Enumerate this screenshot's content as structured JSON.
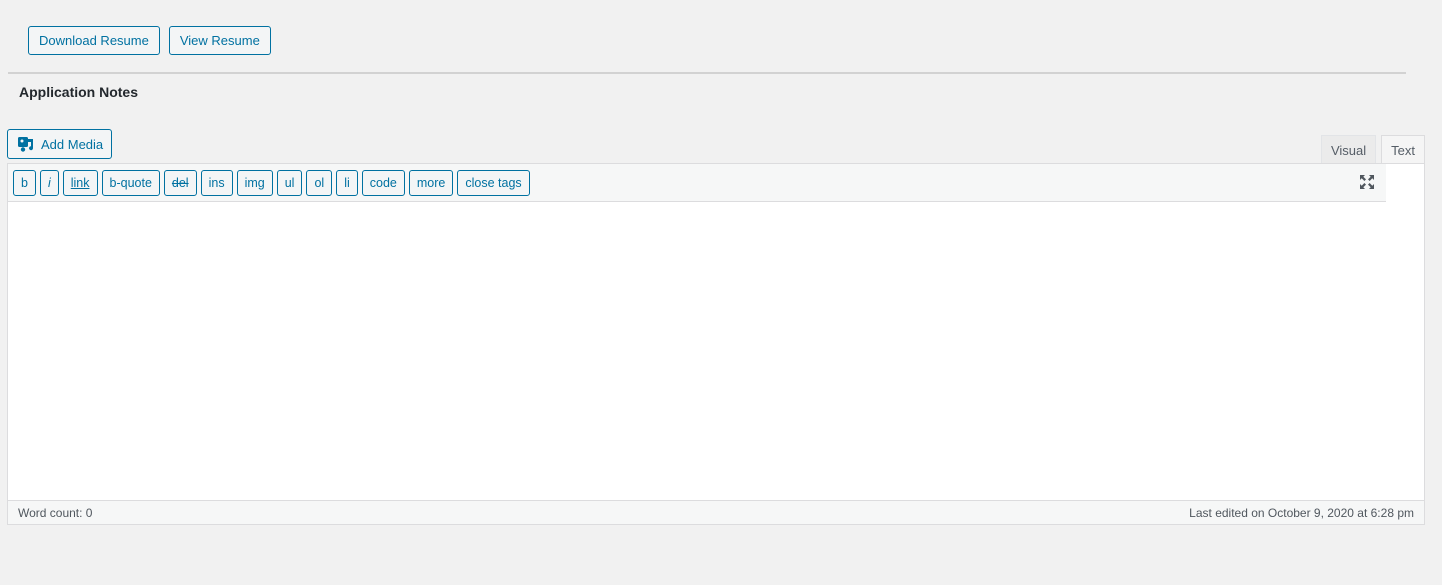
{
  "actions": {
    "download_resume": "Download Resume",
    "view_resume": "View Resume"
  },
  "section": {
    "title": "Application Notes"
  },
  "editor": {
    "add_media_label": "Add Media",
    "tabs": [
      {
        "label": "Visual",
        "active": false
      },
      {
        "label": "Text",
        "active": true
      }
    ],
    "quicktags": [
      "b",
      "i",
      "link",
      "b-quote",
      "del",
      "ins",
      "img",
      "ul",
      "ol",
      "li",
      "code",
      "more",
      "close tags"
    ],
    "content": "",
    "word_count": "Word count: 0",
    "last_edited": "Last edited on October 9, 2020 at 6:28 pm"
  },
  "icons": {
    "add_media": "add-media-icon",
    "fullscreen": "fullscreen-icon"
  },
  "colors": {
    "accent": "#0071a1",
    "background": "#f1f1f1"
  }
}
